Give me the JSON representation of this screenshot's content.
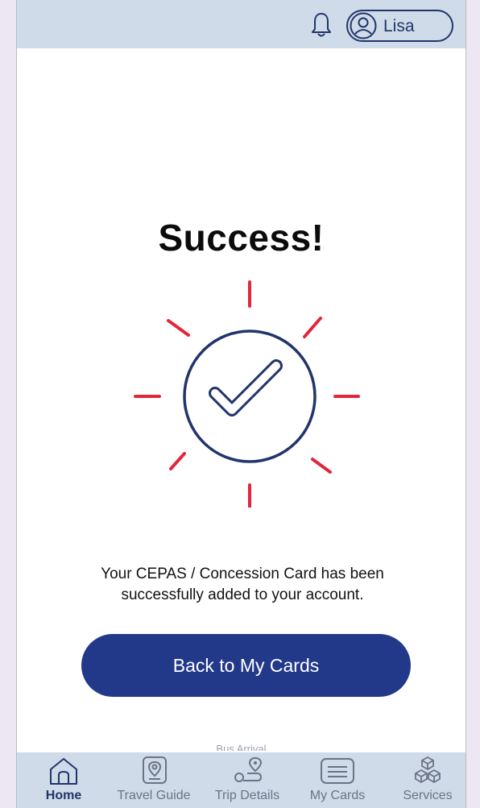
{
  "header": {
    "profile_name": "Lisa"
  },
  "main": {
    "title": "Success!",
    "message_line1": "Your CEPAS / Concession Card has been",
    "message_line2": "successfully added to your account.",
    "back_button_label": "Back to My Cards",
    "faded_text": "Bus Arrival"
  },
  "nav": {
    "items": [
      {
        "label": "Home",
        "icon": "home-icon",
        "active": true
      },
      {
        "label": "Travel Guide",
        "icon": "map-pin-icon",
        "active": false
      },
      {
        "label": "Trip Details",
        "icon": "route-icon",
        "active": false
      },
      {
        "label": "My Cards",
        "icon": "card-icon",
        "active": false
      },
      {
        "label": "Services",
        "icon": "services-icon",
        "active": false
      }
    ]
  },
  "colors": {
    "primary": "#22398a",
    "accent_rays": "#e3263b",
    "bar_background": "#cfdbe8",
    "outline": "#22356b"
  }
}
